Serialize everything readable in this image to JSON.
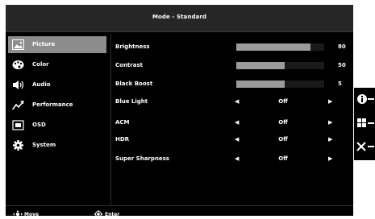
{
  "header": {
    "title": "Mode - Standard"
  },
  "sidebar": {
    "items": [
      {
        "label": "Picture",
        "icon": "picture-icon",
        "active": true
      },
      {
        "label": "Color",
        "icon": "palette-icon",
        "active": false
      },
      {
        "label": "Audio",
        "icon": "speaker-icon",
        "active": false
      },
      {
        "label": "Performance",
        "icon": "performance-icon",
        "active": false
      },
      {
        "label": "OSD",
        "icon": "osd-icon",
        "active": false
      },
      {
        "label": "System",
        "icon": "gear-icon",
        "active": false
      }
    ]
  },
  "settings": {
    "brightness": {
      "label": "Brightness",
      "value": "80",
      "level": 0.84
    },
    "contrast": {
      "label": "Contrast",
      "value": "50",
      "level": 0.55
    },
    "black_boost": {
      "label": "Black Boost",
      "value": "5",
      "level": 0.55
    },
    "blue_light": {
      "label": "Blue Light",
      "value": "Off"
    },
    "acm": {
      "label": "ACM",
      "value": "Off"
    },
    "hdr": {
      "label": "HDR",
      "value": "Off"
    },
    "super_sharpness": {
      "label": "Super Sharpness",
      "value": "Off"
    }
  },
  "footer": {
    "move_label": "Move",
    "enter_label": "Enter"
  },
  "right_buttons": [
    {
      "icon": "info-icon"
    },
    {
      "icon": "grid-menu-icon"
    },
    {
      "icon": "close-icon"
    }
  ],
  "colors": {
    "panel": "#000000",
    "active_item": "#8c8c8c",
    "bar_fill": "#9b9b9b",
    "header": "#262626"
  }
}
